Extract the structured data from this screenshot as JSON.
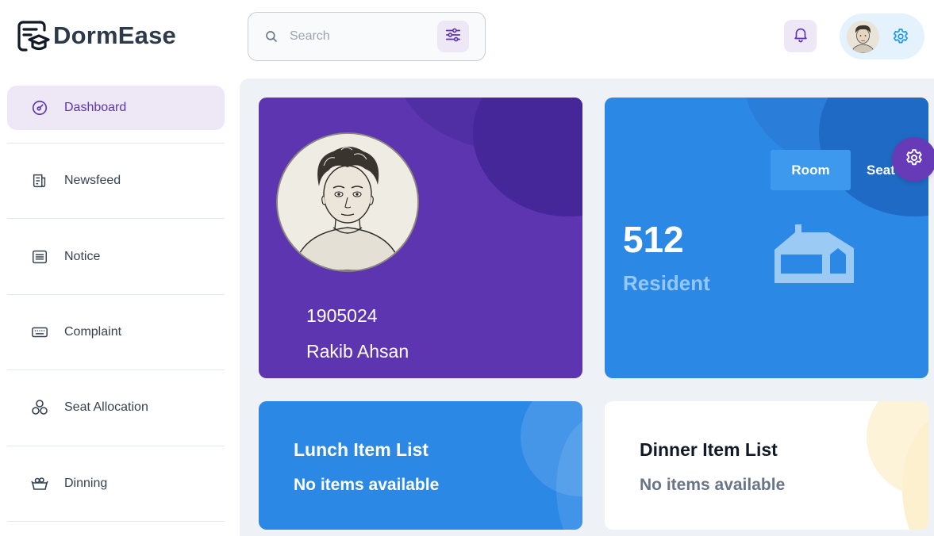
{
  "app": {
    "name": "DormEase",
    "logo_icon": "graduation-cap-logo-icon"
  },
  "header": {
    "search": {
      "placeholder": "Search",
      "value": "",
      "icon": "search-icon",
      "filter_icon": "sliders-icon"
    },
    "notification_icon": "bell-icon",
    "profile_settings_icon": "gear-icon"
  },
  "sidebar": {
    "items": [
      {
        "label": "Dashboard",
        "icon": "dashboard-gauge-icon",
        "active": true
      },
      {
        "label": "Newsfeed",
        "icon": "newspaper-icon",
        "active": false
      },
      {
        "label": "Notice",
        "icon": "list-document-icon",
        "active": false
      },
      {
        "label": "Complaint",
        "icon": "keyboard-icon",
        "active": false
      },
      {
        "label": "Seat Allocation",
        "icon": "circles-icon",
        "active": false
      },
      {
        "label": "Dinning",
        "icon": "food-bowl-icon",
        "active": false
      }
    ]
  },
  "profile_card": {
    "student_id": "1905024",
    "name": "Rakib Ahsan"
  },
  "resident_card": {
    "tabs": [
      "Room",
      "Seat"
    ],
    "active_tab": "Room",
    "count": "512",
    "label": "Resident",
    "icon": "house-icon"
  },
  "lunch_card": {
    "title": "Lunch Item List",
    "empty_text": "No items available"
  },
  "dinner_card": {
    "title": "Dinner Item List",
    "empty_text": "No items available"
  },
  "colors": {
    "primary_purple": "#5e35b1",
    "primary_blue": "#2c88e5",
    "light_purple": "#ede7f6",
    "light_blue": "#e3f2fd",
    "main_bg": "#eef2f6"
  }
}
